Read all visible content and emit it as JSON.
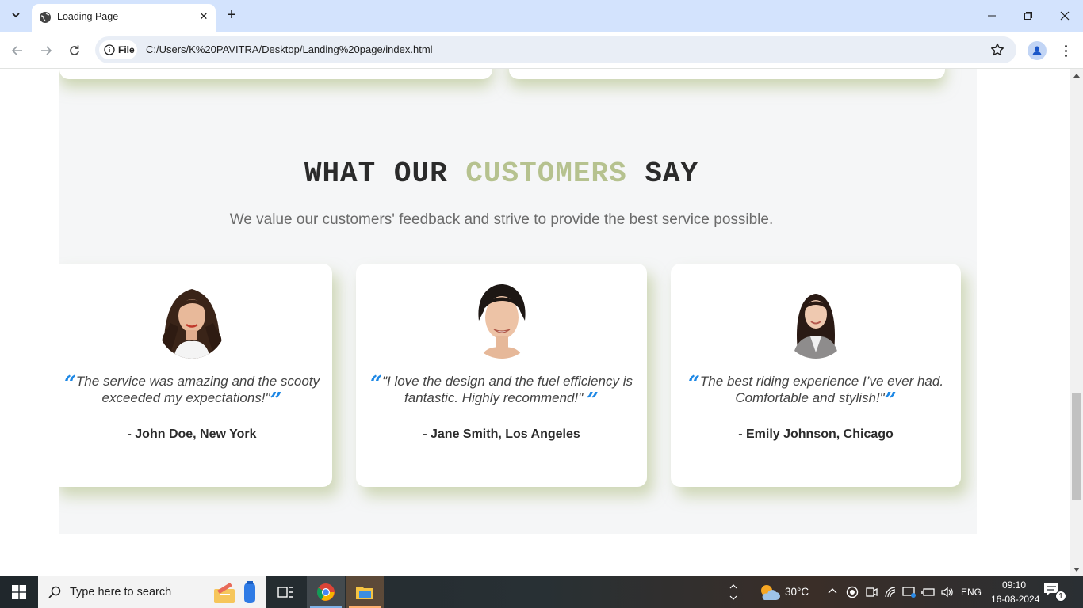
{
  "browser": {
    "tab_title": "Loading Page",
    "site_chip_label": "File",
    "url": "C:/Users/K%20PAVITRA/Desktop/Landing%20page/index.html"
  },
  "section": {
    "heading_part1": "WHAT OUR ",
    "heading_accent": "CUSTOMERS",
    "heading_part2": " SAY",
    "subtitle": "We value our customers' feedback and strive to provide the best service possible.",
    "accent_color": "#b6c28f",
    "quote_color": "#1e88e5"
  },
  "testimonials": [
    {
      "quote": "The service was amazing and the scooty exceeded my expectations!\"",
      "author": "- John Doe, New York"
    },
    {
      "quote": "\"I love the design and the fuel efficiency is fantastic. Highly recommend!\"",
      "author": "- Jane Smith, Los Angeles"
    },
    {
      "quote": "The best riding experience I’ve ever had. Comfortable and stylish!\"",
      "author": "- Emily Johnson, Chicago"
    }
  ],
  "taskbar": {
    "search_placeholder": "Type here to search",
    "weather": "30°C",
    "language": "ENG",
    "time": "09:10",
    "date": "16-08-2024",
    "notification_count": "1"
  }
}
